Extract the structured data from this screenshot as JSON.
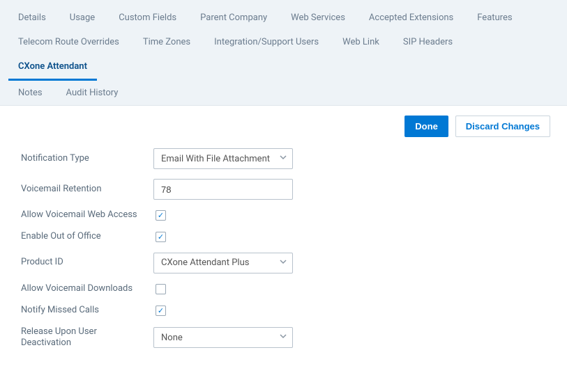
{
  "tabs": {
    "row1": [
      "Details",
      "Usage",
      "Custom Fields",
      "Parent Company",
      "Web Services",
      "Accepted Extensions",
      "Features"
    ],
    "row2": [
      "Telecom Route Overrides",
      "Time Zones",
      "Integration/Support Users",
      "Web Link",
      "SIP Headers",
      "CXone Attendant"
    ],
    "row3": [
      "Notes",
      "Audit History"
    ],
    "active": "CXone Attendant"
  },
  "actions": {
    "done": "Done",
    "discard": "Discard Changes"
  },
  "form": {
    "notification_type": {
      "label": "Notification Type",
      "value": "Email With File Attachment"
    },
    "voicemail_retention": {
      "label": "Voicemail Retention",
      "value": "78"
    },
    "allow_web_access": {
      "label": "Allow Voicemail Web Access",
      "checked": true
    },
    "enable_ooo": {
      "label": "Enable Out of Office",
      "checked": true
    },
    "product_id": {
      "label": "Product ID",
      "value": "CXone Attendant Plus"
    },
    "allow_downloads": {
      "label": "Allow Voicemail Downloads",
      "checked": false
    },
    "notify_missed": {
      "label": "Notify Missed Calls",
      "checked": true
    },
    "release_deactivation": {
      "label": "Release Upon User Deactivation",
      "value": "None"
    }
  }
}
